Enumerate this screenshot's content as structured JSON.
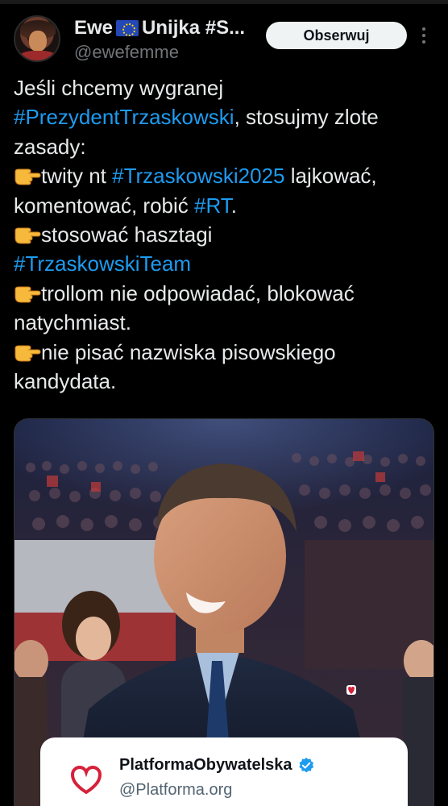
{
  "author": {
    "name_part1": "Ewe",
    "name_flag_icon": "eu-flag-icon",
    "name_part2": "Unijka #S...",
    "handle": "@ewefemme",
    "avatar_icon": "avatar"
  },
  "actions": {
    "follow_label": "Obserwuj",
    "more_icon": "more-vertical-icon"
  },
  "tweet": {
    "l1": "Jeśli  chcemy wygranej",
    "l2_tag": "#PrezydentTrzaskowski",
    "l2_rest": ", stosujmy zlote",
    "l3": "zasady:",
    "l4_pre": "twity nt ",
    "l4_tag": "#Trzaskowski2025",
    "l4_rest": " lajkować,",
    "l5_pre": "komentować, robić ",
    "l5_tag": "#RT",
    "l5_rest": ".",
    "l6": "stosować hasztagi",
    "l7_tag": "#TrzaskowskiTeam",
    "l8": "trollom nie odpowiadać, blokować",
    "l9": "natychmiast.",
    "l10": "nie pisać nazwiska pisowskiego",
    "l11": "kandydata.",
    "emoji_icon": "pointing-right-hand-icon"
  },
  "quoted": {
    "name": "PlatformaObywatelska",
    "handle": "@Platforma.org",
    "logo_icon": "heart-logo-icon",
    "verified_icon": "verified-badge-icon"
  },
  "colors": {
    "background": "#000000",
    "text": "#e7e9ea",
    "secondary": "#71767b",
    "hashtag": "#1d9bf0",
    "follow_bg": "#eff3f4",
    "logo_red": "#d6213a"
  }
}
